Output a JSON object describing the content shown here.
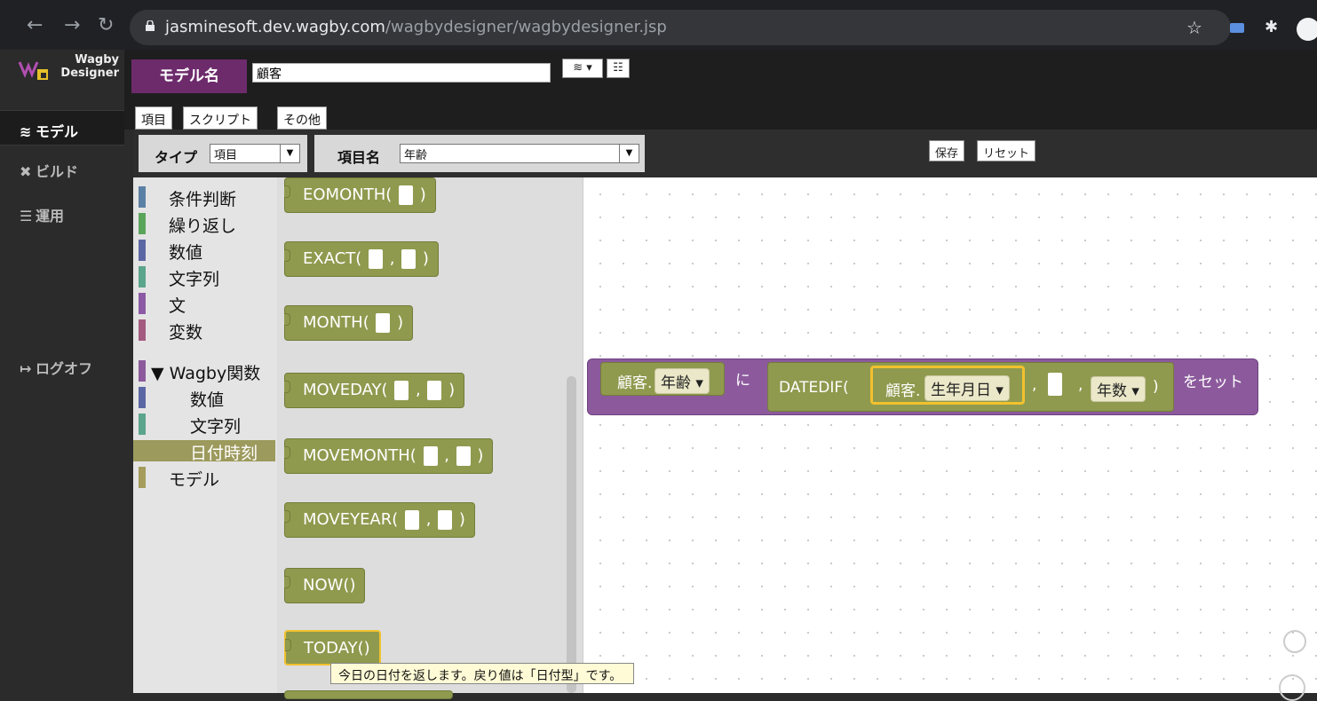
{
  "browser": {
    "url_host": "jasminesoft.dev.wagby.com",
    "url_path": "/wagbydesigner/wagbydesigner.jsp"
  },
  "logo": {
    "line1": "Wagby",
    "line2": "Designer"
  },
  "sidebar": {
    "items": [
      {
        "label": "モデル",
        "icon": "database-icon"
      },
      {
        "label": "ビルド",
        "icon": "tools-icon"
      },
      {
        "label": "運用",
        "icon": "server-icon"
      },
      {
        "label": "ログオフ",
        "icon": "logout-icon"
      }
    ]
  },
  "header": {
    "model_label": "モデル名",
    "model_value": "顧客"
  },
  "tabs": [
    "項目",
    "スクリプト",
    "その他"
  ],
  "fieldbar": {
    "type_label": "タイプ",
    "type_value": "項目",
    "name_label": "項目名",
    "name_value": "年齢",
    "save_label": "保存",
    "reset_label": "リセット"
  },
  "categories": [
    {
      "label": "条件判断",
      "color": "#5b80a5"
    },
    {
      "label": "繰り返し",
      "color": "#5ba55b"
    },
    {
      "label": "数値",
      "color": "#5b67a5"
    },
    {
      "label": "文字列",
      "color": "#5ba58c"
    },
    {
      "label": "文",
      "color": "#8c5aa5"
    },
    {
      "label": "変数",
      "color": "#a55b80"
    },
    {
      "label": "▼ Wagby関数",
      "color": "#8c5a9c"
    },
    {
      "label": "数値",
      "color": "#5b67a5"
    },
    {
      "label": "文字列",
      "color": "#5ba58c"
    },
    {
      "label": "日付時刻",
      "color": "#9c9a5c"
    },
    {
      "label": "モデル",
      "color": "#a59c5b"
    }
  ],
  "flyout_blocks": [
    {
      "label": "EOMONTH(",
      "slots": 1
    },
    {
      "label": "EXACT(",
      "slots": 2
    },
    {
      "label": "MONTH(",
      "slots": 1
    },
    {
      "label": "MOVEDAY(",
      "slots": 2
    },
    {
      "label": "MOVEMONTH(",
      "slots": 2
    },
    {
      "label": "MOVEYEAR(",
      "slots": 2
    },
    {
      "label": "NOW()",
      "slots": 0
    },
    {
      "label": "TODAY()",
      "slots": 0
    }
  ],
  "workspace": {
    "target_model": "顧客.",
    "target_field": "年齢",
    "ni": "に",
    "func": "DATEDIF(",
    "arg_model": "顧客.",
    "arg_field": "生年月日",
    "comma": ",",
    "unit": "年数",
    "close": ")",
    "suffix": "をセット"
  },
  "tooltip": "今日の日付を返します。戻り値は「日付型」です。"
}
